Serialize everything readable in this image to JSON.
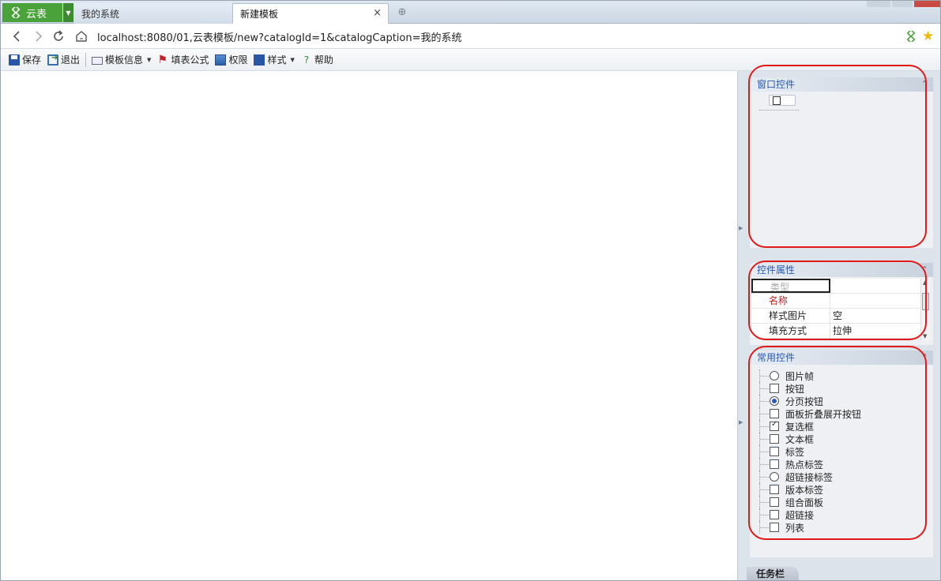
{
  "tabs": {
    "app_name": "云表",
    "items": [
      "我的系统",
      "新建模板"
    ],
    "close_glyph": "×",
    "new_tab_glyph": "⊕"
  },
  "address_bar": {
    "url": "localhost:8080/01,云表模板/new?catalogId=1&catalogCaption=我的系统"
  },
  "toolbar": {
    "save": "保存",
    "exit": "退出",
    "template_info": "模板信息",
    "formula": "填表公式",
    "permission": "权限",
    "style": "样式",
    "help": "帮助"
  },
  "panels": {
    "window_controls": {
      "title": "窗口控件"
    },
    "control_props": {
      "title": "控件属性",
      "rows": [
        {
          "key": "类型",
          "value": ""
        },
        {
          "key": "名称",
          "value": ""
        },
        {
          "key": "样式图片",
          "value": "空"
        },
        {
          "key": "填充方式",
          "value": "拉伸"
        }
      ]
    },
    "common_controls": {
      "title": "常用控件",
      "items": [
        "图片帧",
        "按钮",
        "分页按钮",
        "面板折叠展开按钮",
        "复选框",
        "文本框",
        "标签",
        "热点标签",
        "超链接标签",
        "版本标签",
        "组合面板",
        "超链接",
        "列表"
      ]
    }
  },
  "taskbar": {
    "label": "任务栏"
  },
  "colors": {
    "app_green": "#4aa23a",
    "accent_blue": "#2a56b0",
    "annotation_red": "#e01818"
  }
}
